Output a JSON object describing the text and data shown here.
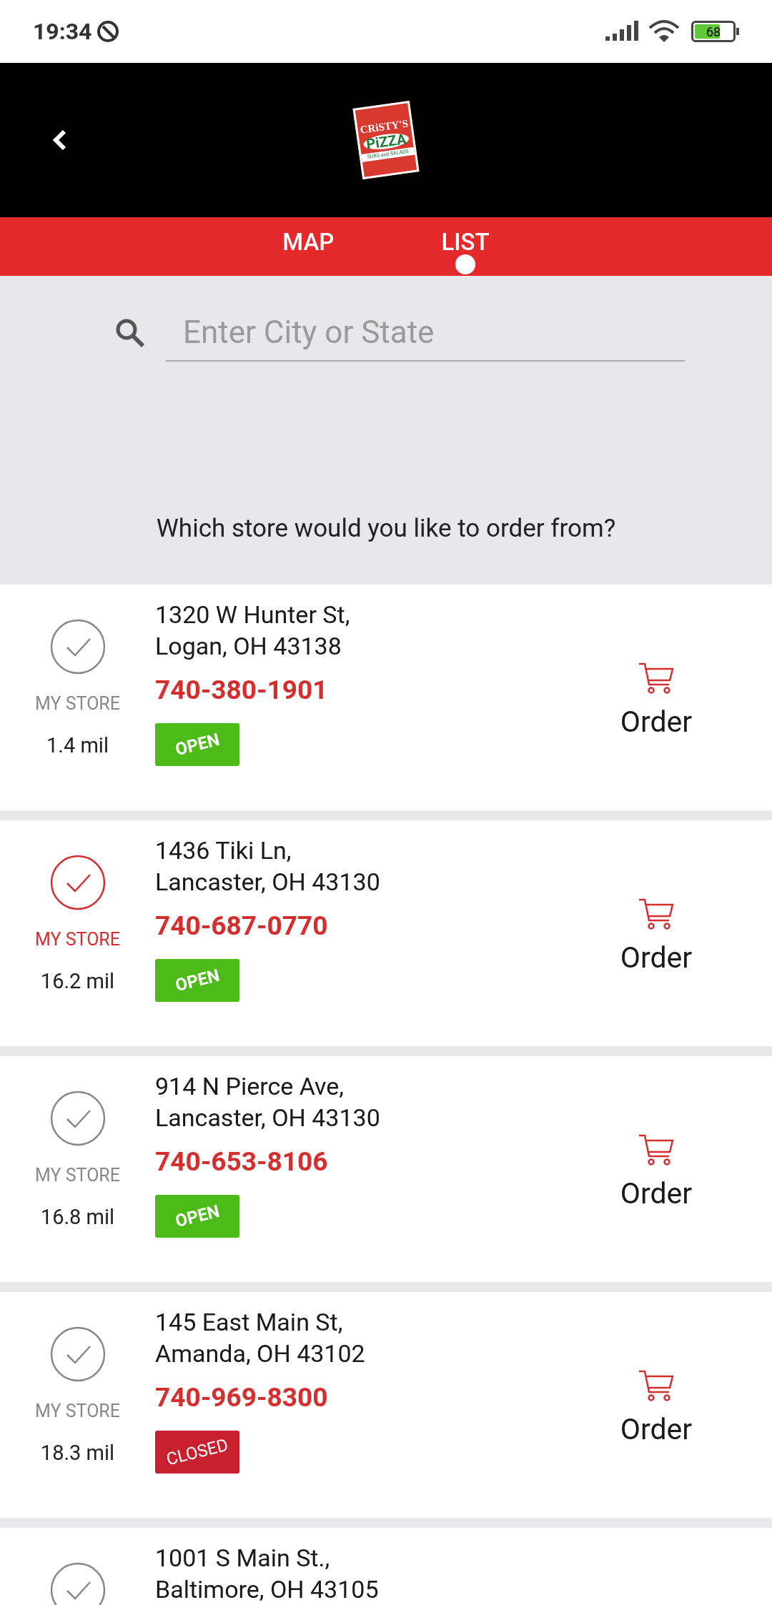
{
  "status_bar": {
    "time": "19:34",
    "battery": "68"
  },
  "header": {
    "logo": {
      "line_1": "CRiSTY'S",
      "line_2": "PiZZA",
      "line_3": "SUBS and SALADS"
    }
  },
  "tabs": [
    {
      "label": "MAP",
      "selected": false
    },
    {
      "label": "LIST",
      "selected": true
    }
  ],
  "search": {
    "placeholder": "Enter City or State"
  },
  "prompt": "Which store would you like to order from?",
  "stores": [
    {
      "address_1": "1320 W Hunter St,",
      "address_2": "Logan, OH 43138",
      "selected": false,
      "my_store": "MY STORE",
      "distance": "1.4 mil",
      "phone": "740-380-1901",
      "status": {
        "kind": "open",
        "label": "OPEN"
      },
      "action": "Order"
    },
    {
      "address_1": "1436 Tiki Ln,",
      "address_2": "Lancaster, OH 43130",
      "selected": true,
      "my_store": "MY STORE",
      "distance": "16.2 mil",
      "phone": "740-687-0770",
      "status": {
        "kind": "open",
        "label": "OPEN"
      },
      "action": "Order"
    },
    {
      "address_1": "914 N Pierce Ave,",
      "address_2": "Lancaster, OH 43130",
      "selected": false,
      "my_store": "MY STORE",
      "distance": "16.8 mil",
      "phone": "740-653-8106",
      "status": {
        "kind": "open",
        "label": "OPEN"
      },
      "action": "Order"
    },
    {
      "address_1": "145 East Main St,",
      "address_2": "Amanda, OH 43102",
      "selected": false,
      "my_store": "MY STORE",
      "distance": "18.3 mil",
      "phone": "740-969-8300",
      "status": {
        "kind": "closed",
        "label": "CLOSED"
      },
      "action": "Order"
    },
    {
      "address_1": "1001 S Main St.,",
      "address_2": "Baltimore, OH 43105",
      "selected": false
    }
  ]
}
